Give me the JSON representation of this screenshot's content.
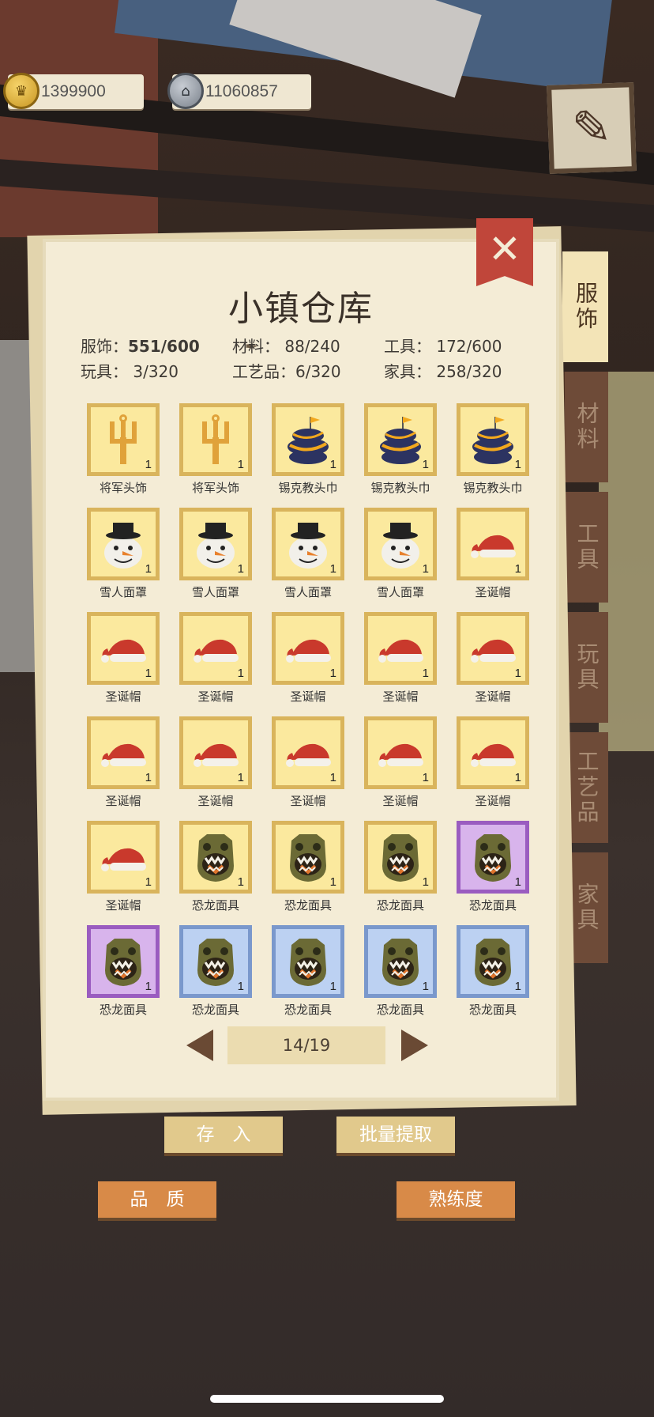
{
  "currency": {
    "gold": "1399900",
    "iron": "11060857"
  },
  "panel": {
    "title": "小镇仓库",
    "stats": {
      "clothing": "服饰：",
      "clothing_value": "551/600",
      "materials": "材料： 88/240",
      "tools": "工具： 172/600",
      "toys": "玩具： 3/320",
      "crafts": "工艺品：6/320",
      "furniture": "家具： 258/320"
    },
    "items": [
      {
        "name": "将军头饰",
        "count": "1",
        "icon": "trident-icon",
        "rarity": "yellow"
      },
      {
        "name": "将军头饰",
        "count": "1",
        "icon": "trident-icon",
        "rarity": "yellow"
      },
      {
        "name": "锡克教头巾",
        "count": "1",
        "icon": "turban-icon",
        "rarity": "yellow"
      },
      {
        "name": "锡克教头巾",
        "count": "1",
        "icon": "turban-icon",
        "rarity": "yellow"
      },
      {
        "name": "锡克教头巾",
        "count": "1",
        "icon": "turban-icon",
        "rarity": "yellow"
      },
      {
        "name": "雪人面罩",
        "count": "1",
        "icon": "snowman-icon",
        "rarity": "yellow"
      },
      {
        "name": "雪人面罩",
        "count": "1",
        "icon": "snowman-icon",
        "rarity": "yellow"
      },
      {
        "name": "雪人面罩",
        "count": "1",
        "icon": "snowman-icon",
        "rarity": "yellow"
      },
      {
        "name": "雪人面罩",
        "count": "1",
        "icon": "snowman-icon",
        "rarity": "yellow"
      },
      {
        "name": "圣诞帽",
        "count": "1",
        "icon": "santa-hat-icon",
        "rarity": "yellow"
      },
      {
        "name": "圣诞帽",
        "count": "1",
        "icon": "santa-hat-icon",
        "rarity": "yellow"
      },
      {
        "name": "圣诞帽",
        "count": "1",
        "icon": "santa-hat-icon",
        "rarity": "yellow"
      },
      {
        "name": "圣诞帽",
        "count": "1",
        "icon": "santa-hat-icon",
        "rarity": "yellow"
      },
      {
        "name": "圣诞帽",
        "count": "1",
        "icon": "santa-hat-icon",
        "rarity": "yellow"
      },
      {
        "name": "圣诞帽",
        "count": "1",
        "icon": "santa-hat-icon",
        "rarity": "yellow"
      },
      {
        "name": "圣诞帽",
        "count": "1",
        "icon": "santa-hat-icon",
        "rarity": "yellow"
      },
      {
        "name": "圣诞帽",
        "count": "1",
        "icon": "santa-hat-icon",
        "rarity": "yellow"
      },
      {
        "name": "圣诞帽",
        "count": "1",
        "icon": "santa-hat-icon",
        "rarity": "yellow"
      },
      {
        "name": "圣诞帽",
        "count": "1",
        "icon": "santa-hat-icon",
        "rarity": "yellow"
      },
      {
        "name": "圣诞帽",
        "count": "1",
        "icon": "santa-hat-icon",
        "rarity": "yellow"
      },
      {
        "name": "圣诞帽",
        "count": "1",
        "icon": "santa-hat-icon",
        "rarity": "yellow"
      },
      {
        "name": "恐龙面具",
        "count": "1",
        "icon": "dino-mask-icon",
        "rarity": "yellow"
      },
      {
        "name": "恐龙面具",
        "count": "1",
        "icon": "dino-mask-icon",
        "rarity": "yellow"
      },
      {
        "name": "恐龙面具",
        "count": "1",
        "icon": "dino-mask-icon",
        "rarity": "yellow"
      },
      {
        "name": "恐龙面具",
        "count": "1",
        "icon": "dino-mask-icon",
        "rarity": "purple"
      },
      {
        "name": "恐龙面具",
        "count": "1",
        "icon": "dino-mask-icon",
        "rarity": "purple"
      },
      {
        "name": "恐龙面具",
        "count": "1",
        "icon": "dino-mask-icon",
        "rarity": "blue"
      },
      {
        "name": "恐龙面具",
        "count": "1",
        "icon": "dino-mask-icon",
        "rarity": "blue"
      },
      {
        "name": "恐龙面具",
        "count": "1",
        "icon": "dino-mask-icon",
        "rarity": "blue"
      },
      {
        "name": "恐龙面具",
        "count": "1",
        "icon": "dino-mask-icon",
        "rarity": "blue"
      }
    ],
    "pager": "14/19"
  },
  "tabs": [
    "服饰",
    "材料",
    "工具",
    "玩具",
    "工艺品",
    "家具"
  ],
  "buttons": {
    "deposit": "存　入",
    "batch_withdraw": "批量提取",
    "quality": "品　质",
    "proficiency": "熟练度"
  },
  "colors": {
    "rarity_yellow": "#fbe99e",
    "rarity_purple": "#d8b4ec",
    "rarity_blue": "#bcd1f2",
    "close": "#c0463a",
    "accent_orange": "#d88a48"
  }
}
